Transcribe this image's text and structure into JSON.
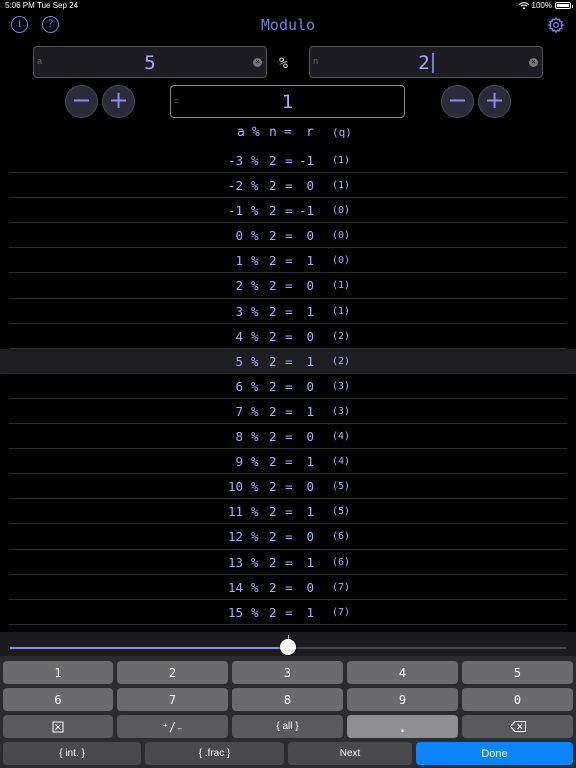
{
  "status_bar": {
    "time": "5:06 PM",
    "date": "Tue Sep 24",
    "battery": "100%"
  },
  "app": {
    "title": "Modulo",
    "accent": "#7b7be0"
  },
  "inputs": {
    "a": {
      "placeholder": "a",
      "value": "5"
    },
    "operator": "%",
    "n": {
      "placeholder": "n",
      "value": "2"
    },
    "result": {
      "placeholder": "=",
      "value": "1"
    }
  },
  "columns": {
    "a": "a",
    "op": "%",
    "n": "n",
    "eq": "=",
    "r": "r",
    "q": "(q)"
  },
  "rows": [
    {
      "a": "-3",
      "op": "%",
      "n": "2",
      "eq": "=",
      "r": "-1",
      "q": "(1)"
    },
    {
      "a": "-2",
      "op": "%",
      "n": "2",
      "eq": "=",
      "r": "0",
      "q": "(1)"
    },
    {
      "a": "-1",
      "op": "%",
      "n": "2",
      "eq": "=",
      "r": "-1",
      "q": "(0)"
    },
    {
      "a": "0",
      "op": "%",
      "n": "2",
      "eq": "=",
      "r": "0",
      "q": "(0)"
    },
    {
      "a": "1",
      "op": "%",
      "n": "2",
      "eq": "=",
      "r": "1",
      "q": "(0)"
    },
    {
      "a": "2",
      "op": "%",
      "n": "2",
      "eq": "=",
      "r": "0",
      "q": "(1)"
    },
    {
      "a": "3",
      "op": "%",
      "n": "2",
      "eq": "=",
      "r": "1",
      "q": "(1)"
    },
    {
      "a": "4",
      "op": "%",
      "n": "2",
      "eq": "=",
      "r": "0",
      "q": "(2)"
    },
    {
      "a": "5",
      "op": "%",
      "n": "2",
      "eq": "=",
      "r": "1",
      "q": "(2)",
      "highlight": true
    },
    {
      "a": "6",
      "op": "%",
      "n": "2",
      "eq": "=",
      "r": "0",
      "q": "(3)"
    },
    {
      "a": "7",
      "op": "%",
      "n": "2",
      "eq": "=",
      "r": "1",
      "q": "(3)"
    },
    {
      "a": "8",
      "op": "%",
      "n": "2",
      "eq": "=",
      "r": "0",
      "q": "(4)"
    },
    {
      "a": "9",
      "op": "%",
      "n": "2",
      "eq": "=",
      "r": "1",
      "q": "(4)"
    },
    {
      "a": "10",
      "op": "%",
      "n": "2",
      "eq": "=",
      "r": "0",
      "q": "(5)"
    },
    {
      "a": "11",
      "op": "%",
      "n": "2",
      "eq": "=",
      "r": "1",
      "q": "(5)"
    },
    {
      "a": "12",
      "op": "%",
      "n": "2",
      "eq": "=",
      "r": "0",
      "q": "(6)"
    },
    {
      "a": "13",
      "op": "%",
      "n": "2",
      "eq": "=",
      "r": "1",
      "q": "(6)"
    },
    {
      "a": "14",
      "op": "%",
      "n": "2",
      "eq": "=",
      "r": "0",
      "q": "(7)"
    },
    {
      "a": "15",
      "op": "%",
      "n": "2",
      "eq": "=",
      "r": "1",
      "q": "(7)"
    }
  ],
  "slider": {
    "value": 0.5
  },
  "keypad": {
    "row1": [
      "1",
      "2",
      "3",
      "4",
      "5"
    ],
    "row2": [
      "6",
      "7",
      "8",
      "9",
      "0"
    ],
    "plusminus": "⁺/₋",
    "all": "{ all }",
    "dot": ".",
    "int": "{ int. }",
    "frac": "{ .frac }",
    "next": "Next",
    "done": "Done"
  }
}
